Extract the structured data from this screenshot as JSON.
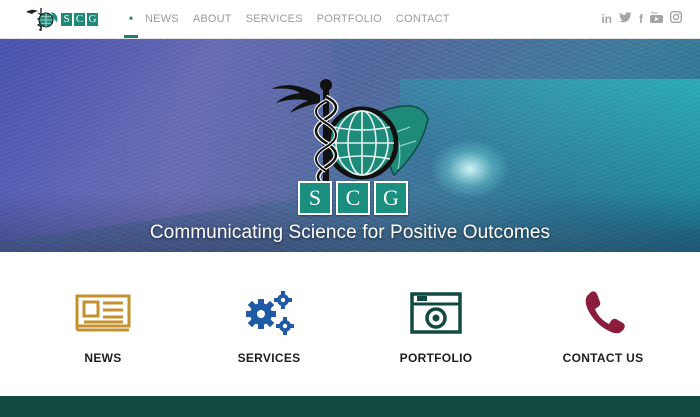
{
  "brand": {
    "logo_letters": [
      "S",
      "C",
      "G"
    ],
    "accent_color": "#1d8a7a"
  },
  "nav": {
    "home_icon": "home-icon",
    "items": [
      {
        "label": "NEWS"
      },
      {
        "label": "ABOUT"
      },
      {
        "label": "SERVICES"
      },
      {
        "label": "PORTFOLIO"
      },
      {
        "label": "CONTACT"
      }
    ],
    "active_color": "#1f7d72"
  },
  "social": {
    "icons": [
      "linkedin-icon",
      "twitter-icon",
      "facebook-icon",
      "youtube-icon",
      "instagram-icon"
    ],
    "glyphs": [
      "in",
      "🐦",
      "f",
      "▶",
      "◎"
    ]
  },
  "hero": {
    "emblem_letters": [
      "S",
      "C",
      "G"
    ],
    "tagline": "Communicating Science for Positive Outcomes"
  },
  "features": [
    {
      "label": "NEWS",
      "icon": "newspaper-icon",
      "color": "#c3922e"
    },
    {
      "label": "SERVICES",
      "icon": "gears-icon",
      "color": "#1f5aa6"
    },
    {
      "label": "PORTFOLIO",
      "icon": "camera-icon",
      "color": "#124a42"
    },
    {
      "label": "CONTACT US",
      "icon": "phone-icon",
      "color": "#8a1d3d"
    }
  ]
}
